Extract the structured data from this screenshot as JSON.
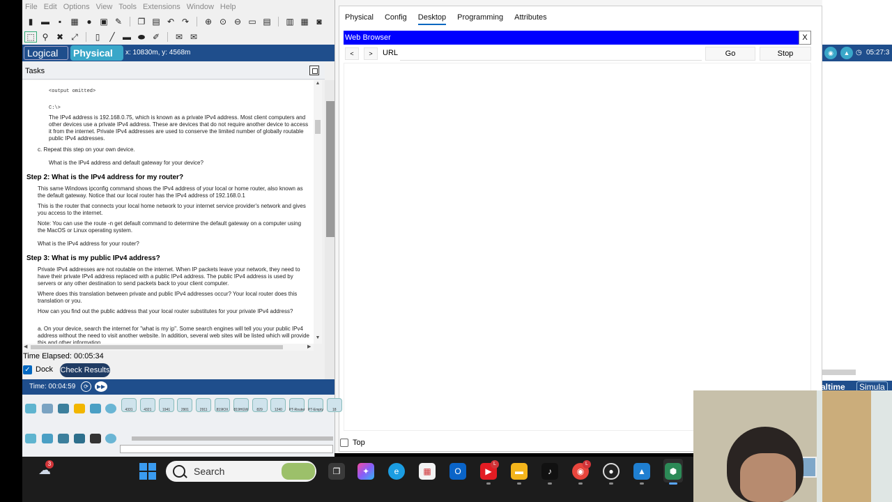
{
  "menu": [
    "File",
    "Edit",
    "Options",
    "View",
    "Tools",
    "Extensions",
    "Window",
    "Help"
  ],
  "views": {
    "logical": "Logical",
    "physical": "Physical",
    "coords": "x: 10830m, y: 4568m"
  },
  "tasks": {
    "header": "Tasks",
    "output_omitted": "<output omitted>",
    "prompt": "C:\\>",
    "para1": "The IPv4 address is 192.168.0.75, which is known as a private IPv4 address. Most client computers and other devices use a private IPv4 address. These are devices that do not require another device to access it from the internet. Private IPv4 addresses are used to conserve the limited number of globally routable public IPv4 addresses.",
    "item_c": "c.   Repeat this step on your own device.",
    "q1": "What is the IPv4 address and default gateway for your device?",
    "step2": "Step 2: What is the IPv4 address for my router?",
    "s2p1": "This same Windows ipconfig command shows the IPv4 address of your local or home router, also known as the default gateway. Notice that our local router has the IPv4 address of 192.168.0.1",
    "s2p2": "This is the router that connects your local home network to your internet service provider's network and gives you access to the internet.",
    "s2note": "Note: You can use the route -n get default command to determine the default gateway on a computer using the MacOS or Linux operating system.",
    "s2q": "What is the IPv4 address for your router?",
    "step3": "Step 3: What is my public IPv4 address?",
    "s3p1": "Private IPv4 addresses are not routable on the internet. When IP packets leave your network, they need to have their private IPv4 address replaced with a public IPv4 address. The public IPv4 address is used by servers or any other destination to send packets back to your client computer.",
    "s3p2": "Where does this translation between private and public IPv4 addresses occur? Your local router does this translation or you.",
    "s3p3": "How can you find out the public address that your local router substitutes for your private IPv4 address?",
    "s3a": "a.   On your device, search the internet for \"what is my ip\". Some search engines will tell you your public IPv4 address without the need to visit another website. In addition, several web sites will be listed which will provide this and other information."
  },
  "elapsed": "Time Elapsed: 00:05:34",
  "dock_label": "Dock",
  "check_results": "Check Results",
  "time": "Time: 00:04:59",
  "device_models": [
    "4331",
    "4321",
    "1941",
    "2901",
    "2911",
    "819IOX",
    "819HGW",
    "829",
    "1240",
    "PT-Router",
    "PT-Empty",
    "18"
  ],
  "dialog": {
    "tabs": [
      "Physical",
      "Config",
      "Desktop",
      "Programming",
      "Attributes"
    ],
    "active_tab": "Desktop",
    "wb_title": "Web Browser",
    "wb_close": "X",
    "back": "<",
    "forward": ">",
    "url_label": "URL",
    "url_value": "",
    "go": "Go",
    "stop": "Stop",
    "top_label": "Top"
  },
  "right": {
    "clock": "05:27:3",
    "realtime": "altime",
    "simulation": "Simula"
  },
  "taskbar": {
    "search_placeholder": "Search",
    "weather_badge": "3",
    "badge_L": "L"
  },
  "colors": {
    "accent": "#1f4e8c",
    "browser_title": "#0000ff",
    "physical_tab": "#3aa7c9"
  }
}
